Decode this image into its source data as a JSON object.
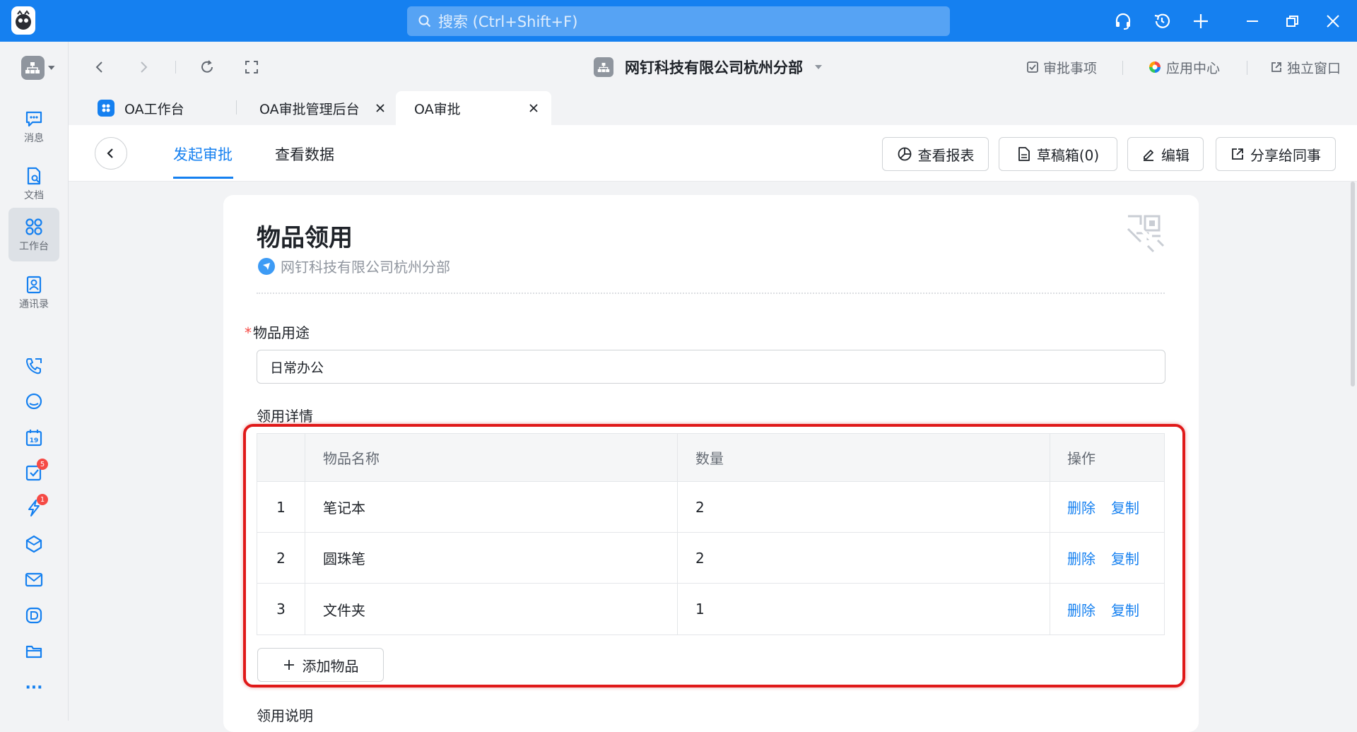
{
  "titlebar": {
    "search_placeholder": "搜索 (Ctrl+Shift+F)"
  },
  "sidebar": {
    "items": [
      {
        "label": "消息",
        "icon": "message-icon"
      },
      {
        "label": "文档",
        "icon": "document-icon"
      },
      {
        "label": "工作台",
        "icon": "workbench-icon",
        "active": true
      },
      {
        "label": "通讯录",
        "icon": "contacts-icon"
      }
    ],
    "quick_icons": [
      "phone-icon",
      "cloud-icon",
      "calendar-icon",
      "todo-icon",
      "ding-icon",
      "cube-icon",
      "mail-icon",
      "docs-d-icon",
      "folder-icon",
      "more-icon"
    ],
    "calendar_day": "19",
    "todo_badge": "5",
    "ding_badge": "1",
    "more_label": "···"
  },
  "navbar": {
    "org_title": "网钉科技有限公司杭州分部",
    "links": [
      {
        "label": "审批事项",
        "icon": "approval-check-icon"
      },
      {
        "label": "应用中心",
        "icon": "app-center-icon"
      },
      {
        "label": "独立窗口",
        "icon": "external-window-icon"
      }
    ]
  },
  "tabs": [
    {
      "label": "OA工作台",
      "closable": false
    },
    {
      "label": "OA审批管理后台",
      "closable": true
    },
    {
      "label": "OA审批",
      "closable": true,
      "active": true
    }
  ],
  "toolbar": {
    "subtabs": [
      {
        "label": "发起审批",
        "active": true
      },
      {
        "label": "查看数据",
        "active": false
      }
    ],
    "buttons": [
      {
        "label": "查看报表",
        "icon": "report-icon"
      },
      {
        "label": "草稿箱(0)",
        "icon": "draft-icon"
      },
      {
        "label": "编辑",
        "icon": "edit-icon"
      },
      {
        "label": "分享给同事",
        "icon": "share-icon"
      }
    ]
  },
  "form": {
    "title": "物品领用",
    "org": "网钉科技有限公司杭州分部",
    "purpose": {
      "label": "物品用途",
      "required_mark": "*",
      "value": "日常办公"
    },
    "details_label": "领用详情",
    "table": {
      "headers": [
        "",
        "物品名称",
        "数量",
        "操作"
      ],
      "rows": [
        {
          "index": "1",
          "name": "笔记本",
          "qty": "2"
        },
        {
          "index": "2",
          "name": "圆珠笔",
          "qty": "2"
        },
        {
          "index": "3",
          "name": "文件夹",
          "qty": "1"
        }
      ],
      "delete_label": "删除",
      "copy_label": "复制"
    },
    "add_button": "添加物品",
    "notes_label": "领用说明"
  },
  "colors": {
    "titlebar": "#1580f0",
    "accent": "#1580f0",
    "highlight_box": "#e01919",
    "badge": "#f54a45"
  }
}
